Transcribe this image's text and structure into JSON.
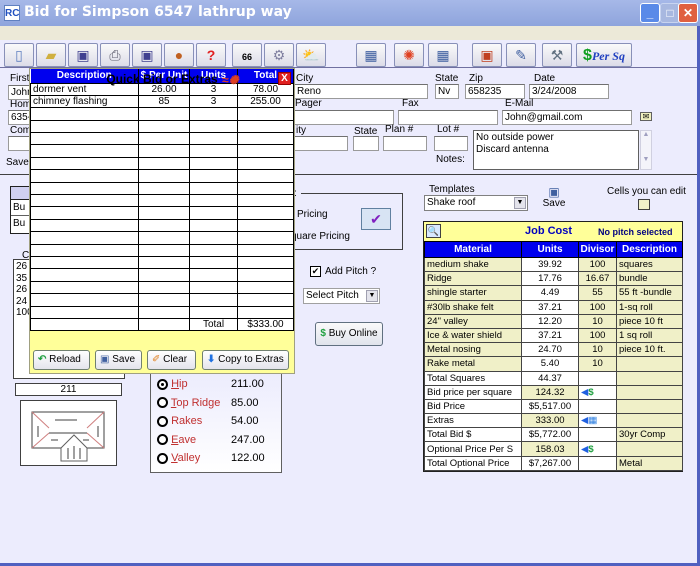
{
  "window": {
    "app_icon": "RC",
    "title": "Bid for Simpson 6547 lathrup way",
    "controls": [
      "minimize",
      "maximize",
      "close"
    ]
  },
  "toolbar": {
    "buttons": [
      {
        "name": "new-document",
        "icon": "📄"
      },
      {
        "name": "open-folder",
        "icon": "📂"
      },
      {
        "name": "save",
        "icon": "💾"
      },
      {
        "name": "print",
        "icon": "🖨"
      },
      {
        "name": "save-edit",
        "icon": "📝"
      },
      {
        "name": "contacts",
        "icon": "👥"
      },
      {
        "name": "help",
        "icon": "?"
      },
      {
        "name": "route-map",
        "icon": "66"
      },
      {
        "name": "settings-tools",
        "icon": "⚙"
      },
      {
        "name": "weather",
        "icon": "⛅"
      },
      {
        "name": "spreadsheet-search",
        "icon": "▦"
      },
      {
        "name": "fire",
        "icon": "🔥"
      },
      {
        "name": "table-search",
        "icon": "▦"
      },
      {
        "name": "photo-frame",
        "icon": "▣"
      },
      {
        "name": "edit-form",
        "icon": "✎"
      },
      {
        "name": "tools",
        "icon": "🔨"
      }
    ],
    "per_sq_label": "Per Sq",
    "per_sq_symbol": "$"
  },
  "customer": {
    "first_label": "First",
    "first_value": "John",
    "home_label": "Home",
    "home_value": "635-",
    "company_label": "Com",
    "save_label": "Save",
    "city_label": "City",
    "city_value": "Reno",
    "state_label": "State",
    "state_value": "Nv",
    "zip_label": "Zip",
    "zip_value": "658235",
    "date_label": "Date",
    "date_value": "3/24/2008",
    "pager_label": "Pager",
    "fax_label": "Fax",
    "email_label": "E-Mail",
    "email_value": "John@gmail.com",
    "city2_label": "ity",
    "state2_label": "State",
    "plan_label": "Plan #",
    "lot_label": "Lot #",
    "notes_label": "Notes:",
    "notes_lines": [
      "No outside power",
      "Discard antenna"
    ]
  },
  "quick_bid": {
    "title": "Quick Bid or Extras",
    "columns": [
      "Description",
      "$ Per Unit",
      "Units",
      "Total"
    ],
    "rows": [
      {
        "description": "dormer vent",
        "per_unit": "26.00",
        "units": "3",
        "total": "78.00"
      },
      {
        "description": "chimney flashing",
        "per_unit": "85",
        "units": "3",
        "total": "255.00"
      }
    ],
    "empty_rows": 17,
    "total_label": "Total",
    "total_value": "$333.00",
    "buttons": {
      "reload": "Reload",
      "save": "Save",
      "clear": "Clear",
      "copy": "Copy to Extras"
    }
  },
  "behind": {
    "bu1": "Bu",
    "bu2": "Bu",
    "c_label": "C",
    "list_values": [
      "26",
      "35",
      "26",
      "24",
      "100"
    ],
    "pricing_group_suffix": "y:",
    "pricing_opt1": "Pricing",
    "pricing_opt2": "quare Pricing",
    "field_211": "211"
  },
  "pitch": {
    "add_pitch_label": "Add Pitch ?",
    "add_pitch_checked": true,
    "select_pitch_value": "Select Pitch",
    "buy_online_label": "Buy Online"
  },
  "roof_lines": [
    {
      "label": "Hip",
      "underline": "H",
      "rest": "ip",
      "value": "211.00",
      "selected": true
    },
    {
      "label": "Top Ridge",
      "underline": "T",
      "rest": "op Ridge",
      "value": "85.00",
      "selected": false
    },
    {
      "label": "Rakes",
      "underline": "",
      "rest": "Rakes",
      "value": "54.00",
      "selected": false
    },
    {
      "label": "Eave",
      "underline": "E",
      "rest": "ave",
      "value": "247.00",
      "selected": false
    },
    {
      "label": "Valley",
      "underline": "V",
      "rest": "alley",
      "value": "122.00",
      "selected": false
    }
  ],
  "templates": {
    "label": "Templates",
    "value": "Shake roof",
    "save_label": "Save",
    "cells_edit_label": "Cells you can edit"
  },
  "job_cost": {
    "title": "Job Cost",
    "pitch_status": "No pitch selected",
    "columns": [
      "Material",
      "Units",
      "Divisor",
      "Description"
    ],
    "rows": [
      {
        "material": "medium shake",
        "units": "39.92",
        "divisor": "100",
        "description": "squares"
      },
      {
        "material": "Ridge",
        "units": "17.76",
        "divisor": "16.67",
        "description": "bundle"
      },
      {
        "material": "shingle starter",
        "units": "4.49",
        "divisor": "55",
        "description": "55 ft -bundle"
      },
      {
        "material": "#30lb shake felt",
        "units": "37.21",
        "divisor": "100",
        "description": "1-sq roll"
      },
      {
        "material": "24\" valley",
        "units": "12.20",
        "divisor": "10",
        "description": "piece 10 ft"
      },
      {
        "material": "Ice & water shield",
        "units": "37.21",
        "divisor": "100",
        "description": "1 sq roll"
      },
      {
        "material": "Metal nosing",
        "units": "24.70",
        "divisor": "10",
        "description": "piece 10 ft."
      },
      {
        "material": "Rake metal",
        "units": "5.40",
        "divisor": "10",
        "description": ""
      }
    ],
    "summary": [
      {
        "label": "Total Squares",
        "value": "44.37",
        "action": "",
        "note": "",
        "editable": false
      },
      {
        "label": "Bid price per square",
        "value": "124.32",
        "action": "dollar",
        "note": "",
        "editable": true
      },
      {
        "label": "Bid Price",
        "value": "$5,517.00",
        "action": "",
        "note": "",
        "editable": false
      },
      {
        "label": "Extras",
        "value": "333.00",
        "action": "calculator",
        "note": "",
        "editable": true
      },
      {
        "label": "Total Bid $",
        "value": "$5,772.00",
        "action": "",
        "note": "30yr Comp",
        "editable": false
      },
      {
        "label": "Optional Price Per S",
        "value": "158.03",
        "action": "dollar",
        "note": "",
        "editable": true
      },
      {
        "label": "Total Optional Price",
        "value": "$7,267.00",
        "action": "",
        "note": "Metal",
        "editable": false
      }
    ]
  },
  "colors": {
    "header_blue": "#0000ee",
    "editable_cream": "#f0f0c8",
    "popup_yellow": "#ffff99",
    "background": "#ececfd",
    "roof_label_red": "#c03030"
  }
}
